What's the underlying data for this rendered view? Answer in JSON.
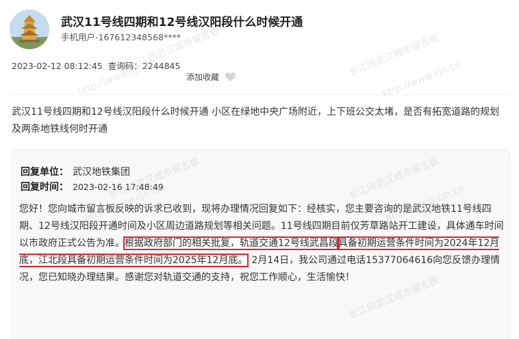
{
  "post": {
    "title": "武汉11号线四期和12号线汉阳段什么时候开通",
    "user": "手机用户-167612348568****",
    "date": "2023-02-12 08:12:45",
    "query_label": "查询码：",
    "query_code": "2244845",
    "favorite_label": "添加收藏",
    "question": "武汉11号线四期和12号线汉阳段什么时候开通  小区在绿地中央广场附近，上下班公交太堵，是否有拓宽道路的规划及两条地铁线何时开通"
  },
  "reply": {
    "unit_label": "回复单位：",
    "unit": "武汉地铁集团",
    "time_label": "回复时间：",
    "time": "2023-02-16 17:48:49",
    "body_before": "您好！您向城市留言板反映的诉求已收到，现将办理情况回复如下：经核实，您主要咨询的是武汉地铁11号线四期、12号线汉阳段开通时间及小区周边道路规划等相关问题。11号线四期目前仅芳草路站开工建设，具体通车时间以市政府正式公告为准。",
    "body_highlight_1": "根据政府部门的相关批复，轨道交通12号线武昌段",
    "body_highlight_2": "具备初期运营条件时间为2024年12月底，江北段具备初期运营条件时间为2025年12月底。",
    "body_after": "2月14日，我公司通过电话15377064616向您反馈办理情况，您已知晓办理结果。感谢您对轨道交通的支持，祝您工作顺心，生活愉快！"
  },
  "watermarks": {
    "cn": "长江网武汉城市留言板",
    "url": "http://www.cjn.cn"
  },
  "colors": {
    "highlight_border": "#d9262f",
    "reply_bg": "#f8f8f8"
  }
}
